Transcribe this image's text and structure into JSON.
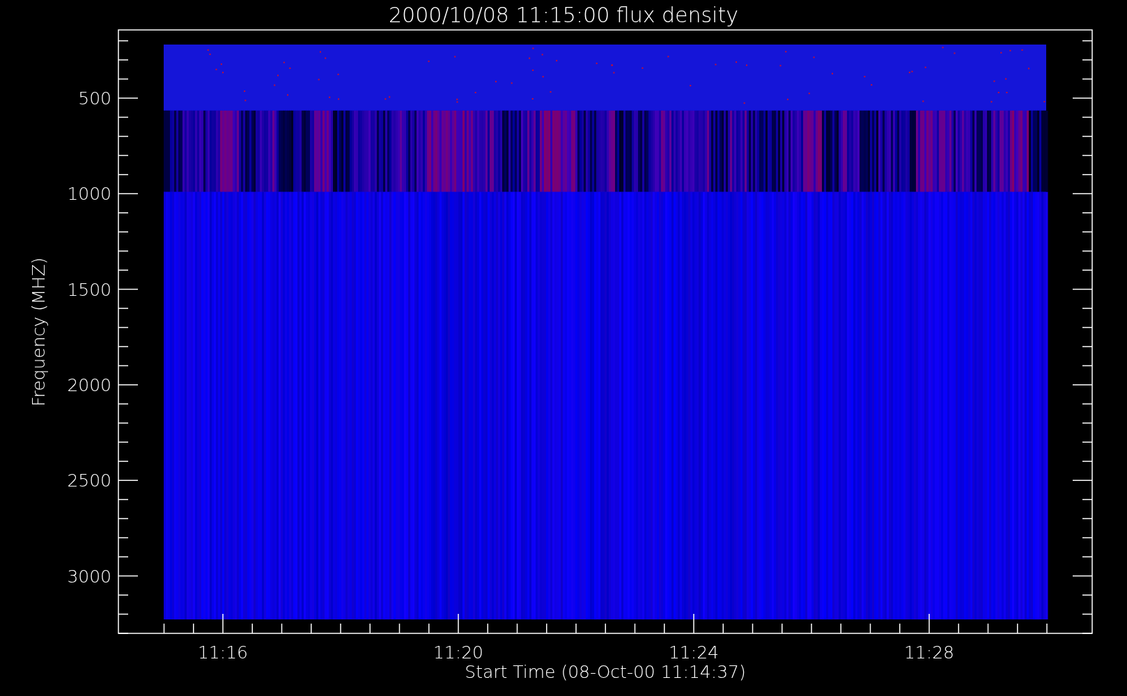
{
  "plot": {
    "title": "2000/10/08 11:15:00 flux density",
    "ylabel": "Frequency (MHZ)",
    "xlabel": "Start Time (08-Oct-00 11:14:37)",
    "yticks": [
      "500",
      "1000",
      "1500",
      "2000",
      "2500",
      "3000"
    ],
    "xticks": [
      "11:16",
      "11:20",
      "11:24",
      "11:28"
    ]
  }
}
